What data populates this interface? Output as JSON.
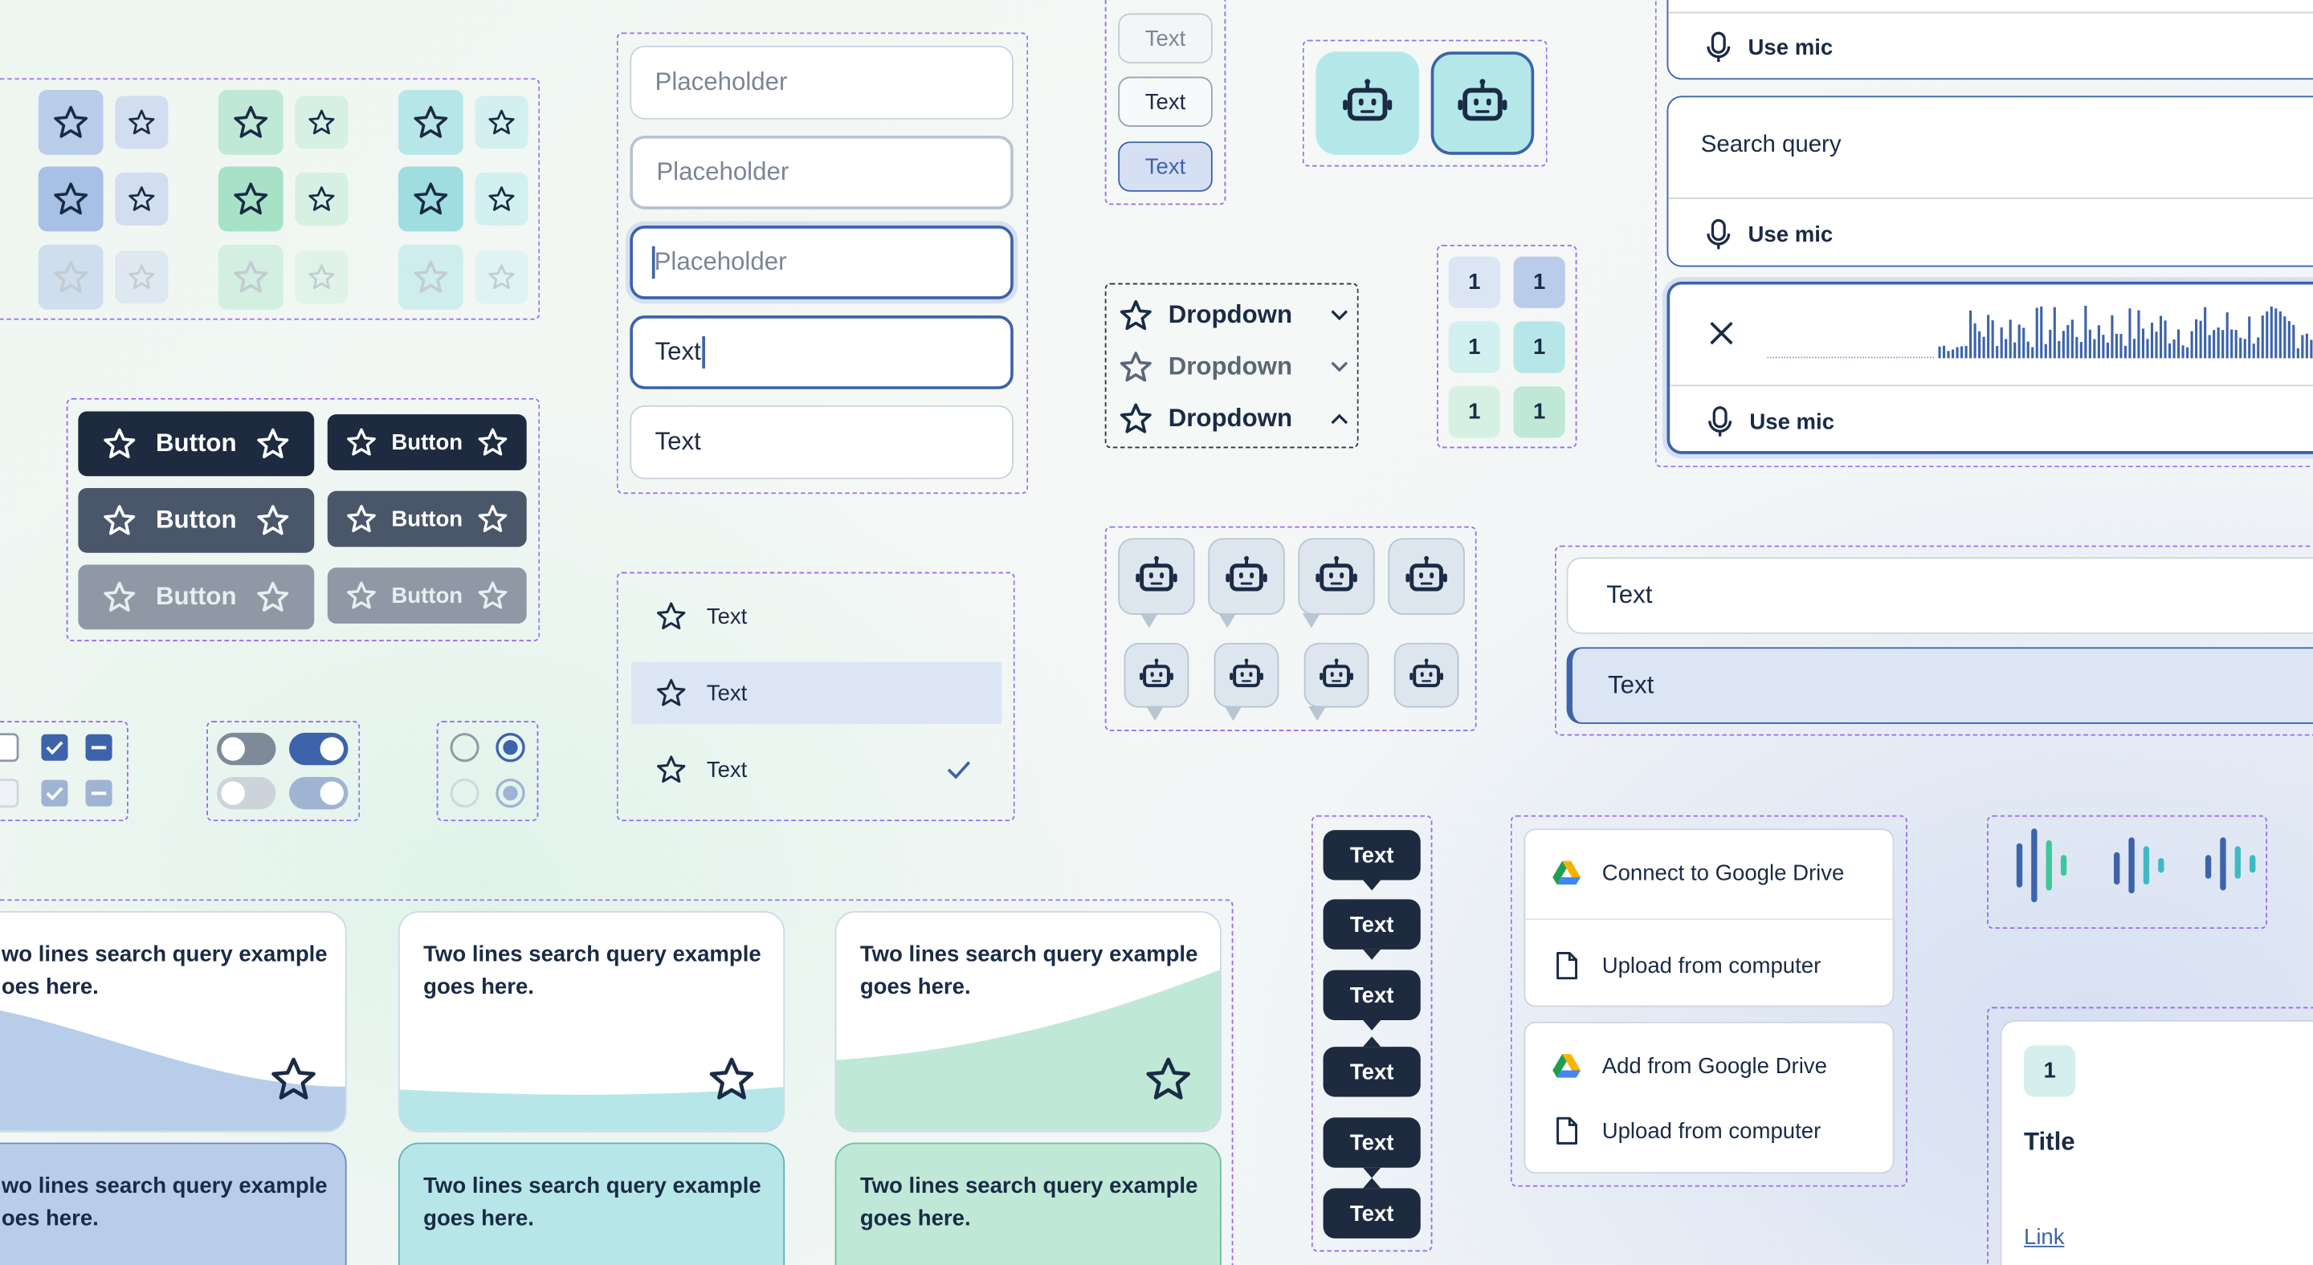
{
  "colors": {
    "navy": "#1a2b45",
    "accent": "#3d63aa",
    "dashed": "#9a6bf0",
    "teal": "#b7e6e8",
    "mint": "#bfe9d6",
    "lilac": "#cdd8ee"
  },
  "buttons": {
    "label": "Button"
  },
  "inputs": [
    {
      "state": "default",
      "placeholder": "Placeholder",
      "value": ""
    },
    {
      "state": "hover",
      "placeholder": "Placeholder",
      "value": ""
    },
    {
      "state": "focused",
      "placeholder": "Placeholder",
      "value": ""
    },
    {
      "state": "typing",
      "placeholder": "",
      "value": "Text"
    },
    {
      "state": "filled",
      "placeholder": "",
      "value": "Text"
    }
  ],
  "chips": [
    "Text",
    "Text",
    "Text"
  ],
  "dropdowns": [
    {
      "label": "Dropdown",
      "icon": "chevron-down-icon"
    },
    {
      "label": "Dropdown",
      "icon": "chevron-down-icon"
    },
    {
      "label": "Dropdown",
      "icon": "chevron-up-icon"
    }
  ],
  "counters": [
    "1",
    "1",
    "1",
    "1",
    "1",
    "1"
  ],
  "menu": [
    "Text",
    "Text",
    "Text"
  ],
  "tooltips": [
    "Text",
    "Text",
    "Text",
    "Text",
    "Text",
    "Text"
  ],
  "search": {
    "mic_label": "Use mic",
    "query": "Search query"
  },
  "textfields": [
    "Text",
    "Text"
  ],
  "upload_menu": [
    "Connect to Google Drive",
    "Upload from computer",
    "Add from Google Drive",
    "Upload from computer"
  ],
  "cards": {
    "text": "Two lines search query example goes here.",
    "cut_text": "wo lines search query example oes here."
  },
  "tile": {
    "count": "1",
    "title": "Title",
    "link": "Link"
  }
}
